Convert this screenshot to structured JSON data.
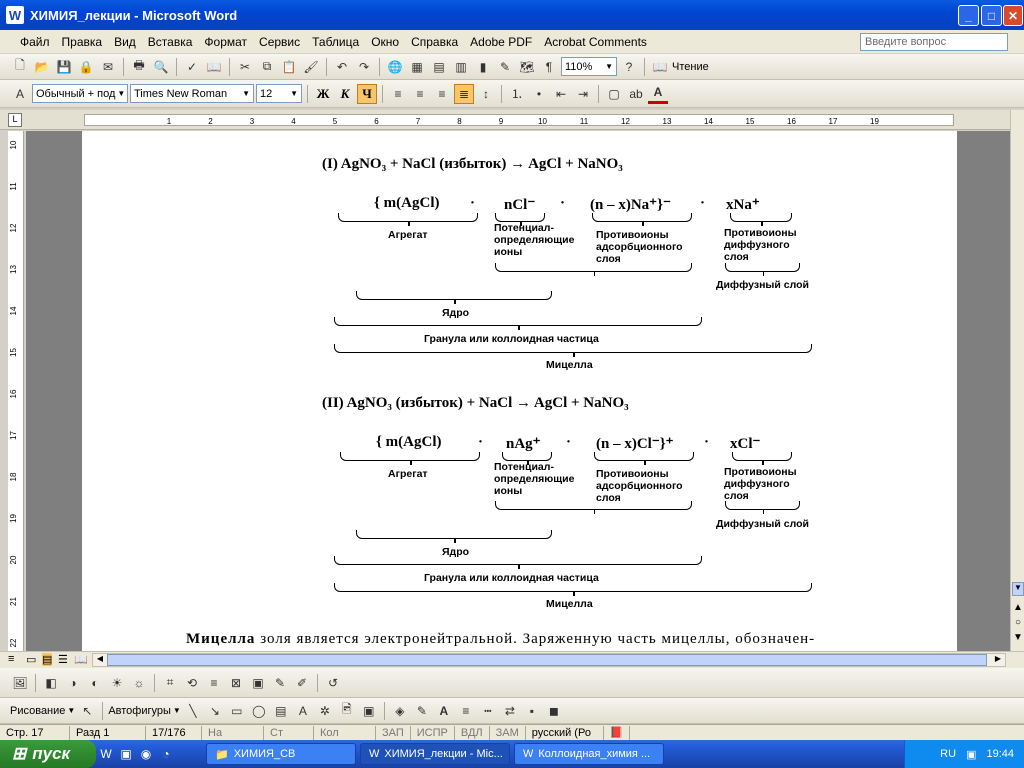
{
  "window": {
    "title": "ХИМИЯ_лекции - Microsoft Word",
    "min": "_",
    "max": "□",
    "close": "✕"
  },
  "menu": [
    "Файл",
    "Правка",
    "Вид",
    "Вставка",
    "Формат",
    "Сервис",
    "Таблица",
    "Окно",
    "Справка",
    "Adobe PDF",
    "Acrobat Comments"
  ],
  "ask_placeholder": "Введите вопрос",
  "toolbar": {
    "zoom": "110%",
    "reading": "Чтение"
  },
  "format": {
    "style": "Обычный + под",
    "font": "Times New Roman",
    "size": "12",
    "bold": "Ж",
    "italic": "К",
    "underline": "Ч"
  },
  "doc": {
    "eq1": "(I)       AgNO₃ + NaCl (избыток) → AgCl + NaNO₃",
    "eq2": "(II)      AgNO₃ (избыток) + NaCl  → AgCl + NaNO₃",
    "m1": {
      "f1": "{ m(AgCl)",
      "f2": "nCl⁻",
      "f3": "(n – x)Na⁺}⁻",
      "f4": "xNa⁺",
      "dot": "·"
    },
    "m2": {
      "f1": "{ m(AgCl)",
      "f2": "nAg⁺",
      "f3": "(n – x)Cl⁻}⁺",
      "f4": "xCl⁻",
      "dot": "·"
    },
    "labels": {
      "agg": "Агрегат",
      "pot1": "Потенциал-",
      "pot2": "определяющие",
      "pot3": "ионы",
      "ads1": "Противоионы",
      "ads2": "адсорбционного",
      "ads3": "слоя",
      "dif1": "Противоионы",
      "dif2": "диффузного",
      "dif3": "слоя",
      "diflayer": "Диффузный слой",
      "core": "Ядро",
      "granule": "Гранула или коллоидная частица",
      "micelle": "Мицелла"
    },
    "para_bold": "Мицелла",
    "para_rest": " золя является электронейтральной. Заряженную часть мицеллы, обозначен-"
  },
  "ruler_v": [
    "10",
    "11",
    "12",
    "13",
    "14",
    "15",
    "16",
    "17",
    "18",
    "19",
    "20",
    "21",
    "22"
  ],
  "ruler_h": [
    "1",
    "2",
    "3",
    "4",
    "5",
    "6",
    "7",
    "8",
    "9",
    "10",
    "11",
    "12",
    "13",
    "14",
    "15",
    "16",
    "17",
    "19"
  ],
  "drawing": {
    "draw": "Рисование",
    "autoshapes": "Автофигуры"
  },
  "status": {
    "page": "Стр. 17",
    "section": "Разд 1",
    "pages": "17/176",
    "at": "На",
    "line": "Ст",
    "col": "Кол",
    "rec": "ЗАП",
    "trk": "ИСПР",
    "ext": "ВДЛ",
    "ovr": "ЗАМ",
    "lang": "русский (Ро"
  },
  "taskbar": {
    "start": "пуск",
    "tasks": [
      "ХИМИЯ_СВ",
      "ХИМИЯ_лекции - Mic...",
      "Коллоидная_химия ..."
    ],
    "lang": "RU",
    "time": "19:44"
  }
}
